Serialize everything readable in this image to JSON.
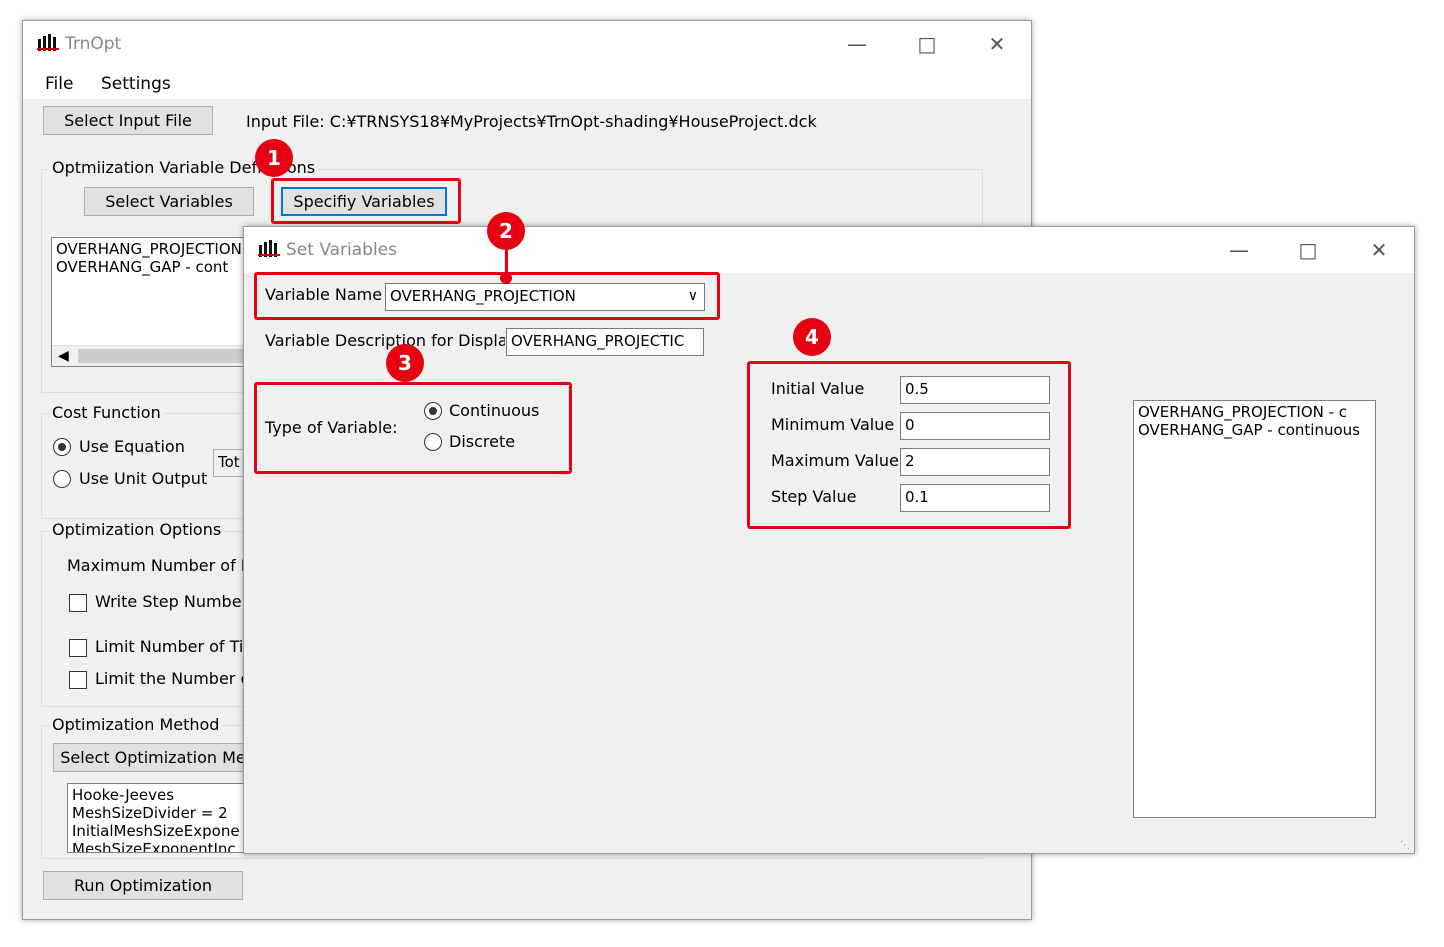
{
  "main_window": {
    "title": "TrnOpt",
    "menu": [
      "File",
      "Settings"
    ],
    "select_input_button": "Select Input File",
    "input_file": "Input File: C:¥TRNSYS18¥MyProjects¥TrnOpt-shading¥HouseProject.dck",
    "opt_var_group": "Optmiization Variable Definitions",
    "select_variables_button": "Select Variables",
    "specify_variables_button": "Specifiy Variables",
    "variables_list": [
      "OVERHANG_PROJECTION",
      "OVERHANG_GAP - cont"
    ],
    "cost_function_group": "Cost Function",
    "use_equation": "Use Equation",
    "use_unit_output": "Use Unit Output",
    "cost_input_value": "Tot",
    "opt_options_group": "Optimization Options",
    "max_iter_label": "Maximum Number of Ite",
    "write_step": "Write Step Number",
    "limit_time": "Limit Number of Tir",
    "limit_number": "Limit the Number o",
    "opt_method_group": "Optimization Method",
    "select_method_button": "Select Optimization Me",
    "method_lines": [
      "Hooke-Jeeves",
      "MeshSizeDivider = 2",
      "InitialMeshSizeExpone",
      "MeshSizeExponentInc"
    ],
    "run_button": "Run Optimization"
  },
  "dialog": {
    "title": "Set Variables",
    "variable_name_label": "Variable Name",
    "variable_name_value": "OVERHANG_PROJECTION",
    "description_label": "Variable Description for Display",
    "description_value": "OVERHANG_PROJECTIC",
    "type_label": "Type of Variable:",
    "continuous": "Continuous",
    "discrete": "Discrete",
    "initial_label": "Initial Value",
    "initial_value": "0.5",
    "min_label": "Minimum Value",
    "min_value": "0",
    "max_label": "Maximum Value",
    "max_value": "2",
    "step_label": "Step Value",
    "step_value": "0.1",
    "list_items": [
      "OVERHANG_PROJECTION - c",
      "OVERHANG_GAP - continuous"
    ]
  },
  "badges": [
    "1",
    "2",
    "3",
    "4"
  ],
  "colors": {
    "highlight": "#e60012",
    "window_bg": "#f0f0f0",
    "focus": "#0078d7"
  }
}
